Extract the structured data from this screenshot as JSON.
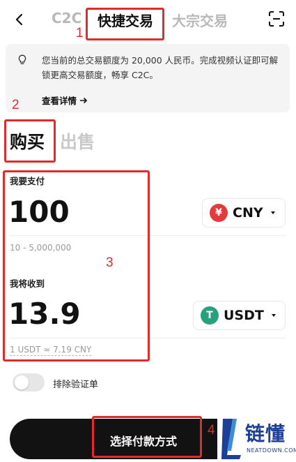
{
  "header": {
    "tabs": [
      {
        "label": "C2C"
      },
      {
        "label": "快捷交易"
      },
      {
        "label": "大宗交易"
      }
    ]
  },
  "notice": {
    "text": "您当前的总交易额度为 20,000 人民币。完成视频认证即可解锁更高交易额度，畅享 C2C。",
    "link_label": "查看详情"
  },
  "side": {
    "buy_label": "购买",
    "sell_label": "出售"
  },
  "pay": {
    "label": "我要支付",
    "amount": "100",
    "range_hint": "10 - 5,000,000",
    "currency": "CNY",
    "currency_symbol": "¥"
  },
  "receive": {
    "label": "我将收到",
    "amount": "13.9",
    "rate_hint": "1 USDT ≈ 7.19 CNY",
    "currency": "USDT",
    "currency_symbol": "T"
  },
  "toggle": {
    "label": "排除验证单",
    "on": false
  },
  "cta": {
    "label": "选择付款方式"
  },
  "annotations": {
    "n1": "1",
    "n2": "2",
    "n3": "3",
    "n4": "4"
  },
  "watermark": {
    "cn": "链懂",
    "en": "NEATDOWN.COM"
  },
  "colors": {
    "cny_red": "#e23b3b",
    "usdt_green": "#26a17b",
    "annotation_red": "#e02b2b",
    "watermark_blue": "#1e3f96"
  }
}
